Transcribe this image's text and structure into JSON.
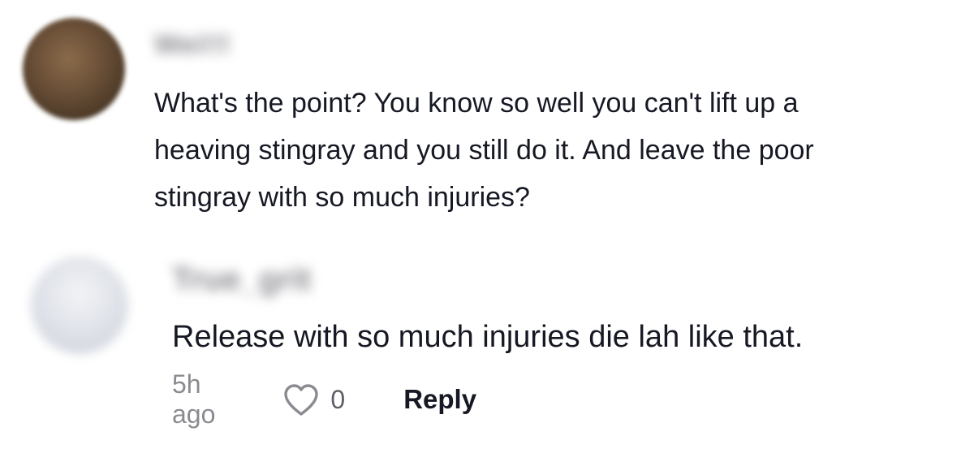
{
  "comments": [
    {
      "username": "Wei!!!",
      "text_lines": [
        "What's the point? You know so well you can't lift up a",
        "heaving stingray and you still do it. And leave the poor",
        "stingray with so much injuries?"
      ]
    },
    {
      "username": "True_grit",
      "text": "Release with so much injuries die lah like that.",
      "time": "5h ago",
      "like_count": "0",
      "reply_label": "Reply"
    }
  ],
  "icons": {
    "like": "heart-icon"
  },
  "colors": {
    "text": "#161823",
    "muted": "#8a8b91"
  }
}
